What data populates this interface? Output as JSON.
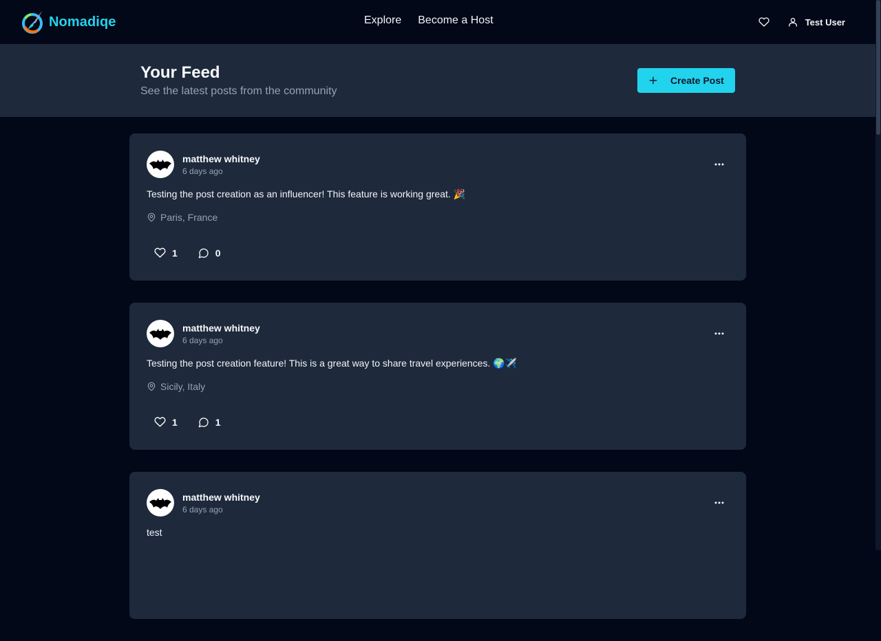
{
  "navbar": {
    "brand": "Nomadiqe",
    "links": [
      "Explore",
      "Become a Host"
    ],
    "user_name": "Test User",
    "icons": {
      "favorites": "heart-icon",
      "user": "user-icon",
      "logo": "compass-logo"
    }
  },
  "header": {
    "title": "Your Feed",
    "subtitle": "See the latest posts from the community",
    "create_label": "Create Post"
  },
  "posts": [
    {
      "author": "matthew whitney",
      "time": "6 days ago",
      "content": "Testing the post creation as an influencer! This feature is working great. 🎉",
      "location": "Paris, France",
      "likes": "1",
      "comments": "0"
    },
    {
      "author": "matthew whitney",
      "time": "6 days ago",
      "content": "Testing the post creation feature! This is a great way to share travel experiences. 🌍✈️",
      "location": "Sicily, Italy",
      "likes": "1",
      "comments": "1"
    },
    {
      "author": "matthew whitney",
      "time": "6 days ago",
      "content": "test",
      "location": "",
      "likes": "",
      "comments": ""
    }
  ],
  "colors": {
    "background": "#020817",
    "card": "#1e293b",
    "accent": "#22d3ee",
    "muted_text": "#94a3b8"
  }
}
